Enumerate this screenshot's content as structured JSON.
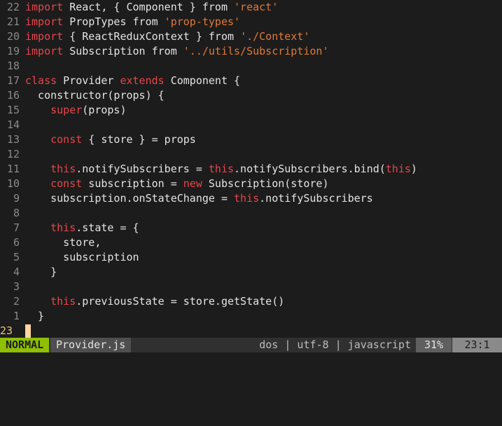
{
  "editor": {
    "lines": [
      {
        "num": "22",
        "tokens": [
          {
            "t": "kw",
            "v": "import"
          },
          {
            "t": "plain",
            "v": " React, { Component } from "
          },
          {
            "t": "str",
            "v": "'react'"
          }
        ]
      },
      {
        "num": "21",
        "tokens": [
          {
            "t": "kw",
            "v": "import"
          },
          {
            "t": "plain",
            "v": " PropTypes from "
          },
          {
            "t": "str",
            "v": "'prop-types'"
          }
        ]
      },
      {
        "num": "20",
        "tokens": [
          {
            "t": "kw",
            "v": "import"
          },
          {
            "t": "plain",
            "v": " { ReactReduxContext } from "
          },
          {
            "t": "str",
            "v": "'./Context'"
          }
        ]
      },
      {
        "num": "19",
        "tokens": [
          {
            "t": "kw",
            "v": "import"
          },
          {
            "t": "plain",
            "v": " Subscription from "
          },
          {
            "t": "str",
            "v": "'../utils/Subscription'"
          }
        ]
      },
      {
        "num": "18",
        "tokens": []
      },
      {
        "num": "17",
        "tokens": [
          {
            "t": "kw",
            "v": "class"
          },
          {
            "t": "plain",
            "v": " Provider "
          },
          {
            "t": "kw",
            "v": "extends"
          },
          {
            "t": "plain",
            "v": " Component {"
          }
        ]
      },
      {
        "num": "16",
        "tokens": [
          {
            "t": "plain",
            "v": "  constructor(props) {"
          }
        ]
      },
      {
        "num": "15",
        "tokens": [
          {
            "t": "plain",
            "v": "    "
          },
          {
            "t": "kw",
            "v": "super"
          },
          {
            "t": "plain",
            "v": "(props)"
          }
        ]
      },
      {
        "num": "14",
        "tokens": []
      },
      {
        "num": "13",
        "tokens": [
          {
            "t": "plain",
            "v": "    "
          },
          {
            "t": "kw",
            "v": "const"
          },
          {
            "t": "plain",
            "v": " { store } = props"
          }
        ]
      },
      {
        "num": "12",
        "tokens": []
      },
      {
        "num": "11",
        "tokens": [
          {
            "t": "plain",
            "v": "    "
          },
          {
            "t": "kw",
            "v": "this"
          },
          {
            "t": "plain",
            "v": ".notifySubscribers = "
          },
          {
            "t": "kw",
            "v": "this"
          },
          {
            "t": "plain",
            "v": ".notifySubscribers.bind("
          },
          {
            "t": "kw",
            "v": "this"
          },
          {
            "t": "plain",
            "v": ")"
          }
        ]
      },
      {
        "num": "10",
        "tokens": [
          {
            "t": "plain",
            "v": "    "
          },
          {
            "t": "kw",
            "v": "const"
          },
          {
            "t": "plain",
            "v": " subscription = "
          },
          {
            "t": "kw",
            "v": "new"
          },
          {
            "t": "plain",
            "v": " Subscription(store)"
          }
        ]
      },
      {
        "num": "9",
        "tokens": [
          {
            "t": "plain",
            "v": "    subscription.onStateChange = "
          },
          {
            "t": "kw",
            "v": "this"
          },
          {
            "t": "plain",
            "v": ".notifySubscribers"
          }
        ]
      },
      {
        "num": "8",
        "tokens": []
      },
      {
        "num": "7",
        "tokens": [
          {
            "t": "plain",
            "v": "    "
          },
          {
            "t": "kw",
            "v": "this"
          },
          {
            "t": "plain",
            "v": ".state = {"
          }
        ]
      },
      {
        "num": "6",
        "tokens": [
          {
            "t": "plain",
            "v": "      store,"
          }
        ]
      },
      {
        "num": "5",
        "tokens": [
          {
            "t": "plain",
            "v": "      subscription"
          }
        ]
      },
      {
        "num": "4",
        "tokens": [
          {
            "t": "plain",
            "v": "    }"
          }
        ]
      },
      {
        "num": "3",
        "tokens": []
      },
      {
        "num": "2",
        "tokens": [
          {
            "t": "plain",
            "v": "    "
          },
          {
            "t": "kw",
            "v": "this"
          },
          {
            "t": "plain",
            "v": ".previousState = store.getState()"
          }
        ]
      },
      {
        "num": "1",
        "tokens": [
          {
            "t": "plain",
            "v": "  }"
          }
        ]
      },
      {
        "num": "23",
        "tokens": [],
        "cursor": true
      }
    ]
  },
  "statusline": {
    "mode": "NORMAL",
    "filename": "Provider.js",
    "fileformat": "dos",
    "encoding": "utf-8",
    "filetype": "javascript",
    "right_info": "dos | utf-8 | javascript",
    "percent": "31%",
    "position": "23:1"
  },
  "colors": {
    "keyword": "#e8454a",
    "string": "#e07a38",
    "mode_bg": "#8fbf00",
    "background": "#1c1c1c"
  }
}
